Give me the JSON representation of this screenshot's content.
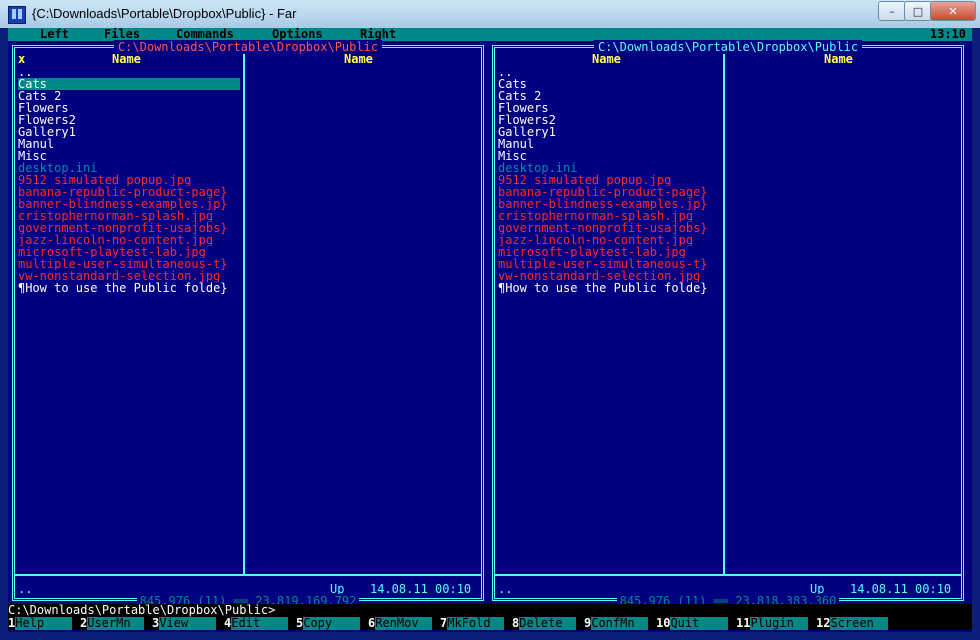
{
  "window": {
    "title": "{C:\\Downloads\\Portable\\Dropbox\\Public} - Far",
    "minimize": "–",
    "maximize": "□",
    "close": "✕"
  },
  "menu": {
    "items": [
      "Left",
      "Files",
      "Commands",
      "Options",
      "Right"
    ],
    "clock": "13:10"
  },
  "left_panel": {
    "path": "C:\\Downloads\\Portable\\Dropbox\\Public",
    "sort_marker": "x",
    "col1": "Name",
    "col2": "Name",
    "files": [
      {
        "name": "..",
        "kind": "up"
      },
      {
        "name": "Cats",
        "kind": "dir"
      },
      {
        "name": "Cats_2",
        "kind": "dir"
      },
      {
        "name": "Flowers",
        "kind": "dir"
      },
      {
        "name": "Flowers2",
        "kind": "dir"
      },
      {
        "name": "Gallery1",
        "kind": "dir"
      },
      {
        "name": "Manul",
        "kind": "dir"
      },
      {
        "name": "Misc",
        "kind": "dir"
      },
      {
        "name": "desktop.ini",
        "kind": "sys"
      },
      {
        "name": "9512_simulated_popup.jpg",
        "kind": "img"
      },
      {
        "name": "banana-republic-product-page}",
        "kind": "img"
      },
      {
        "name": "banner-blindness-examples.jp}",
        "kind": "img"
      },
      {
        "name": "cristophernorman-splash.jpg",
        "kind": "img"
      },
      {
        "name": "government-nonprofit-usajobs}",
        "kind": "img"
      },
      {
        "name": "jazz-lincoln-no-content.jpg",
        "kind": "img"
      },
      {
        "name": "microsoft-playtest-lab.jpg",
        "kind": "img"
      },
      {
        "name": "multiple-user-simultaneous-t}",
        "kind": "img"
      },
      {
        "name": "vw-nonstandard-selection.jpg",
        "kind": "img"
      },
      {
        "name": "¶How to use the Public folde}",
        "kind": "doc"
      }
    ],
    "info_name": "..",
    "info_up": "Up",
    "info_date": "14.08.11 00:10",
    "status": "845,976 (11) ══ 23,819,169,792"
  },
  "right_panel": {
    "path": "C:\\Downloads\\Portable\\Dropbox\\Public",
    "col1": "Name",
    "col2": "Name",
    "files": [
      {
        "name": "..",
        "kind": "up"
      },
      {
        "name": "Cats",
        "kind": "dir"
      },
      {
        "name": "Cats_2",
        "kind": "dir"
      },
      {
        "name": "Flowers",
        "kind": "dir"
      },
      {
        "name": "Flowers2",
        "kind": "dir"
      },
      {
        "name": "Gallery1",
        "kind": "dir"
      },
      {
        "name": "Manul",
        "kind": "dir"
      },
      {
        "name": "Misc",
        "kind": "dir"
      },
      {
        "name": "desktop.ini",
        "kind": "sys"
      },
      {
        "name": "9512_simulated_popup.jpg",
        "kind": "img"
      },
      {
        "name": "banana-republic-product-page}",
        "kind": "img"
      },
      {
        "name": "banner-blindness-examples.jp}",
        "kind": "img"
      },
      {
        "name": "cristophernorman-splash.jpg",
        "kind": "img"
      },
      {
        "name": "government-nonprofit-usajobs}",
        "kind": "img"
      },
      {
        "name": "jazz-lincoln-no-content.jpg",
        "kind": "img"
      },
      {
        "name": "microsoft-playtest-lab.jpg",
        "kind": "img"
      },
      {
        "name": "multiple-user-simultaneous-t}",
        "kind": "img"
      },
      {
        "name": "vw-nonstandard-selection.jpg",
        "kind": "img"
      },
      {
        "name": "¶How to use the Public folde}",
        "kind": "doc"
      }
    ],
    "info_name": "..",
    "info_up": "Up",
    "info_date": "14.08.11 00:10",
    "status": "845,976 (11) ══ 23,818,383,360"
  },
  "command_line": "C:\\Downloads\\Portable\\Dropbox\\Public>",
  "keybar": [
    {
      "num": "1",
      "label": "Help"
    },
    {
      "num": "2",
      "label": "UserMn"
    },
    {
      "num": "3",
      "label": "View"
    },
    {
      "num": "4",
      "label": "Edit"
    },
    {
      "num": "5",
      "label": "Copy"
    },
    {
      "num": "6",
      "label": "RenMov"
    },
    {
      "num": "7",
      "label": "MkFold"
    },
    {
      "num": "8",
      "label": "Delete"
    },
    {
      "num": "9",
      "label": "ConfMn"
    },
    {
      "num": "10",
      "label": "Quit"
    },
    {
      "num": "11",
      "label": "Plugin"
    },
    {
      "num": "12",
      "label": "Screen"
    }
  ]
}
